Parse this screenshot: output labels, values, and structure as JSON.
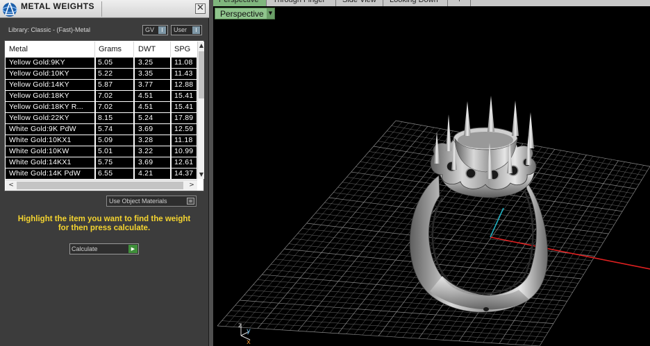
{
  "panel": {
    "title": "METAL WEIGHTS",
    "close_glyph": "✕",
    "library_label": "Library: Classic - (Fast)-Metal",
    "toggles": [
      {
        "label": "GV",
        "state": "I"
      },
      {
        "label": "User",
        "state": "I"
      }
    ]
  },
  "table": {
    "columns": [
      "Metal",
      "Grams",
      "DWT",
      "SPG"
    ],
    "rows": [
      {
        "metal": "Yellow Gold:9KY",
        "grams": "5.05",
        "dwt": "3.25",
        "spg": "11.08"
      },
      {
        "metal": "Yellow Gold:10KY",
        "grams": "5.22",
        "dwt": "3.35",
        "spg": "11.43"
      },
      {
        "metal": "Yellow Gold:14KY",
        "grams": "5.87",
        "dwt": "3.77",
        "spg": "12.88"
      },
      {
        "metal": "Yellow Gold:18KY",
        "grams": "7.02",
        "dwt": "4.51",
        "spg": "15.41"
      },
      {
        "metal": "Yellow Gold:18KY R...",
        "grams": "7.02",
        "dwt": "4.51",
        "spg": "15.41"
      },
      {
        "metal": "Yellow Gold:22KY",
        "grams": "8.15",
        "dwt": "5.24",
        "spg": "17.89"
      },
      {
        "metal": "White Gold:9K PdW",
        "grams": "5.74",
        "dwt": "3.69",
        "spg": "12.59"
      },
      {
        "metal": "White Gold:10KX1",
        "grams": "5.09",
        "dwt": "3.28",
        "spg": "11.18"
      },
      {
        "metal": "White Gold:10KW",
        "grams": "5.01",
        "dwt": "3.22",
        "spg": "10.99"
      },
      {
        "metal": "White Gold:14KX1",
        "grams": "5.75",
        "dwt": "3.69",
        "spg": "12.61"
      },
      {
        "metal": "White Gold:14K PdW",
        "grams": "6.55",
        "dwt": "4.21",
        "spg": "14.37"
      }
    ],
    "scroll_up": "▲",
    "scroll_down": "▼",
    "scroll_left": "<",
    "scroll_right": ">"
  },
  "options": {
    "use_object_materials_label": "Use Object Materials"
  },
  "hint": {
    "line1": "Highlight the item you want to find the weight",
    "line2": "for then press calculate."
  },
  "calculate": {
    "label": "Calculate",
    "go_glyph": "▶"
  },
  "viewport": {
    "tabs": [
      "Perspective",
      "Through Finger",
      "Side View",
      "Looking Down"
    ],
    "add_tab_glyph": "+",
    "active_view": "Perspective",
    "dropdown_arrow": "▼",
    "axis_labels": {
      "x": "x",
      "y": "y",
      "z": "z"
    }
  },
  "colors": {
    "tab_active": "#7fb67d",
    "hint_text": "#f4d430",
    "axis_x": "#e02020",
    "axis_y": "#20b0c0",
    "grid": "#8a8a8a"
  },
  "icons": {
    "app_logo": "app-logo-icon",
    "close": "close-icon",
    "go": "play-arrow-icon"
  }
}
